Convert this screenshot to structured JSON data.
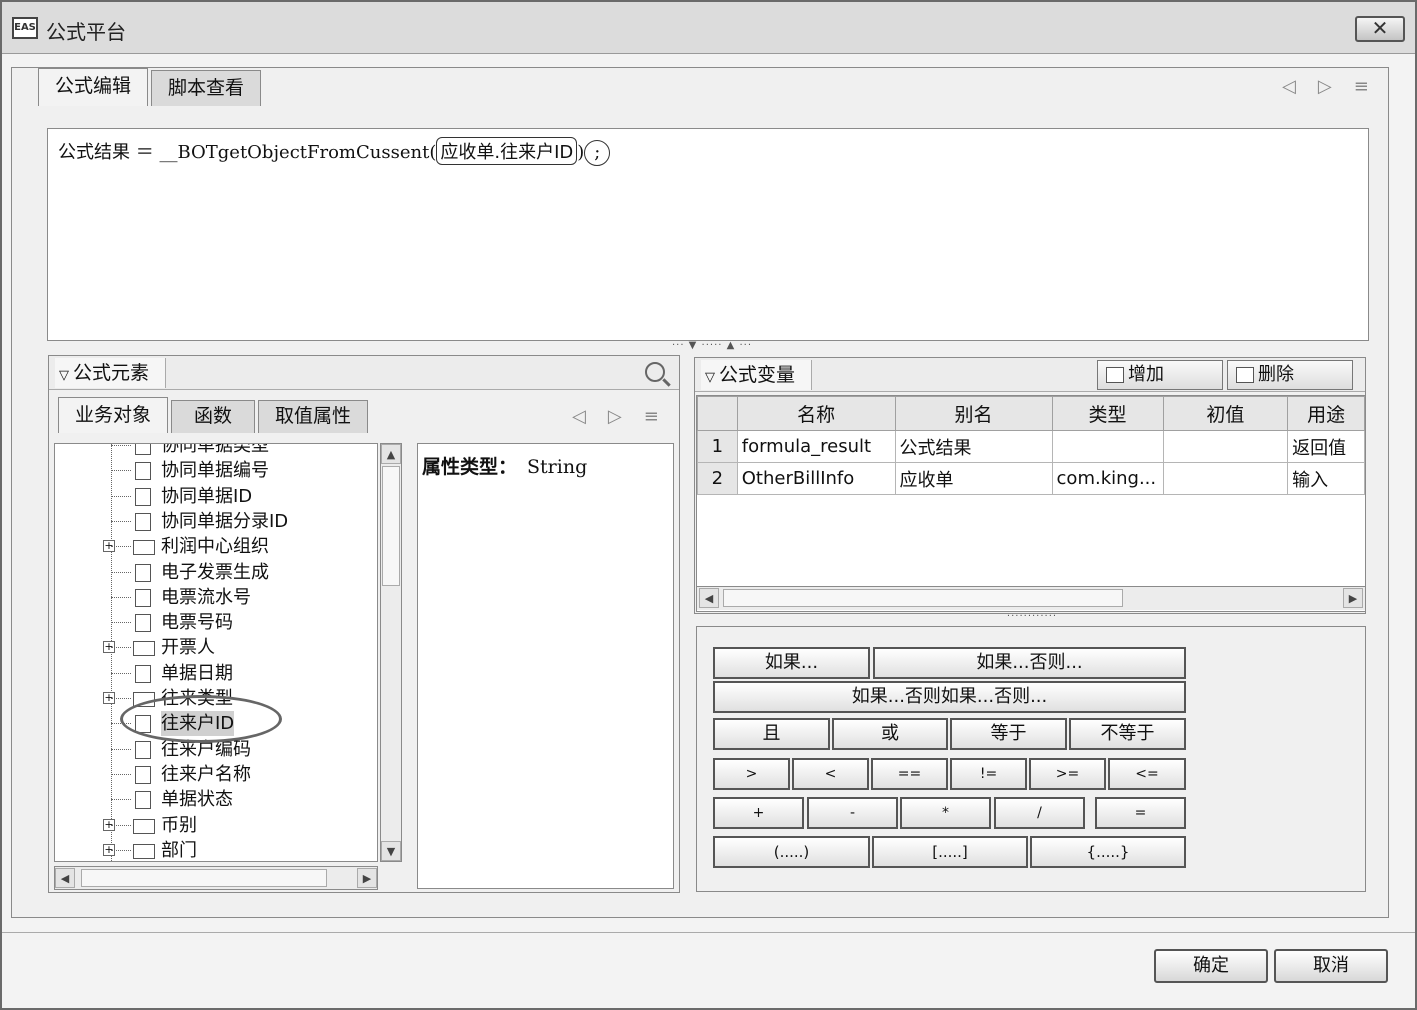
{
  "window": {
    "title": "公式平台",
    "icon_label": "EAS",
    "close_label": "✕"
  },
  "main_tabs": [
    {
      "label": "公式编辑"
    },
    {
      "label": "脚本查看"
    }
  ],
  "editor": {
    "prefix": "公式结果 ＝ __BOTgetObjectFromCussent(",
    "token": "应收单.往来户ID",
    "suffix": ")",
    "end": ";"
  },
  "elements_panel": {
    "title": "公式元素",
    "tabs": [
      {
        "label": "业务对象"
      },
      {
        "label": "函数"
      },
      {
        "label": "取值属性"
      }
    ]
  },
  "tree": {
    "items": [
      {
        "label": "协同单据类型",
        "icon": "doc",
        "expandable": false
      },
      {
        "label": "协同单据编号",
        "icon": "doc",
        "expandable": false
      },
      {
        "label": "协同单据ID",
        "icon": "doc",
        "expandable": false
      },
      {
        "label": "协同单据分录ID",
        "icon": "doc",
        "expandable": false
      },
      {
        "label": "利润中心组织",
        "icon": "folder",
        "expandable": true
      },
      {
        "label": "电子发票生成",
        "icon": "doc",
        "expandable": false
      },
      {
        "label": "电票流水号",
        "icon": "doc",
        "expandable": false
      },
      {
        "label": "电票号码",
        "icon": "doc",
        "expandable": false
      },
      {
        "label": "开票人",
        "icon": "folder",
        "expandable": true
      },
      {
        "label": "单据日期",
        "icon": "doc",
        "expandable": false
      },
      {
        "label": "往来类型",
        "icon": "folder",
        "expandable": true
      },
      {
        "label": "往来户ID",
        "icon": "doc",
        "expandable": false,
        "selected": true
      },
      {
        "label": "往来户编码",
        "icon": "doc",
        "expandable": false
      },
      {
        "label": "往来户名称",
        "icon": "doc",
        "expandable": false
      },
      {
        "label": "单据状态",
        "icon": "doc",
        "expandable": false
      },
      {
        "label": "币别",
        "icon": "folder",
        "expandable": true
      },
      {
        "label": "部门",
        "icon": "folder",
        "expandable": true
      }
    ]
  },
  "property": {
    "label": "属性类型：",
    "value": "String"
  },
  "variables_panel": {
    "title": "公式变量",
    "add_label": "增加",
    "delete_label": "删除",
    "columns": [
      "名称",
      "别名",
      "类型",
      "初值",
      "用途"
    ],
    "rows": [
      {
        "num": "1",
        "name": "formula_result",
        "alias": "公式结果",
        "type": "",
        "init": "",
        "use": "返回值"
      },
      {
        "num": "2",
        "name": "OtherBillInfo",
        "alias": "应收单",
        "type": "com.king...",
        "init": "",
        "use": "输入"
      }
    ]
  },
  "operators": {
    "if": "如果...",
    "if_else": "如果...否则...",
    "if_elseif": "如果...否则如果...否则...",
    "and": "且",
    "or": "或",
    "eq": "等于",
    "neq": "不等于",
    "gt": ">",
    "lt": "<",
    "eqeq": "==",
    "ne": "!=",
    "ge": ">=",
    "le": "<=",
    "plus": "+",
    "minus": "-",
    "mul": "*",
    "div": "/",
    "assign": "=",
    "paren": "(.....)",
    "bracket": "[.....]",
    "brace": "{.....}"
  },
  "dialog": {
    "ok": "确定",
    "cancel": "取消"
  }
}
